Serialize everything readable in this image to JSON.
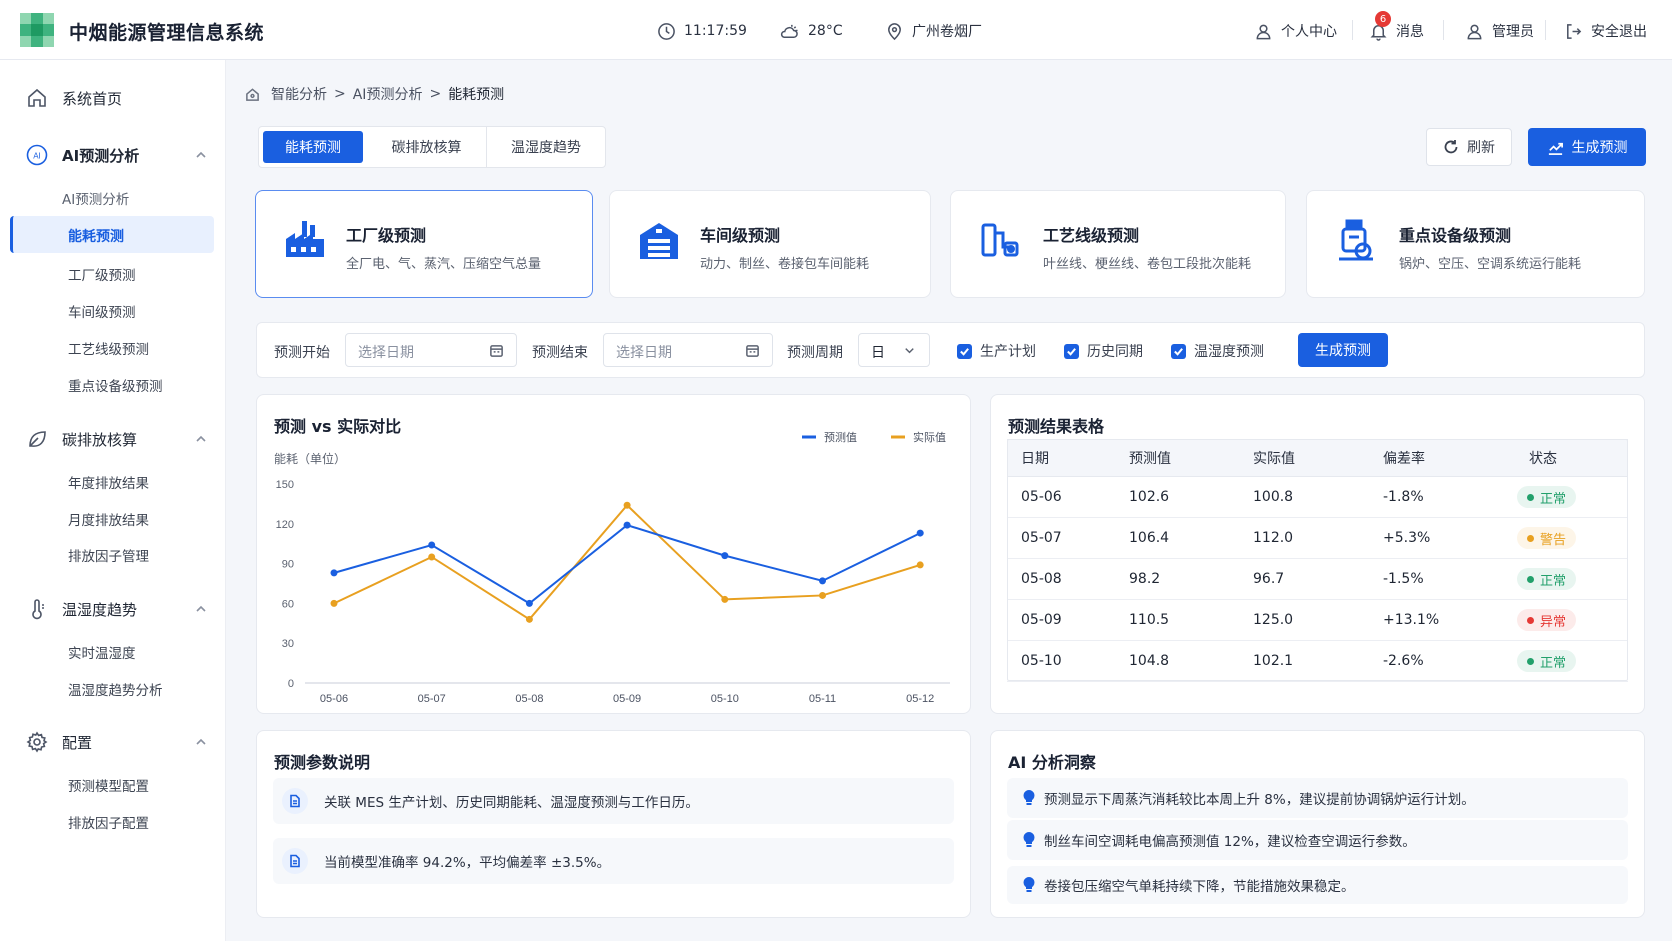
{
  "app": {
    "title": "中烟能源管理信息系统"
  },
  "header": {
    "time": "11:17:59",
    "weather": "28°C",
    "location": "广州卷烟厂",
    "personal_center": "个人中心",
    "messages": "消息",
    "message_count": "6",
    "user": "管理员",
    "logout": "安全退出"
  },
  "sidebar": {
    "home": "系统首页",
    "ai_group": "AI预测分析",
    "ai_sub_label": "AI预测分析",
    "ai_items": [
      "能耗预测",
      "工厂级预测",
      "车间级预测",
      "工艺线级预测",
      "重点设备级预测"
    ],
    "carbon_group": "碳排放核算",
    "carbon_items": [
      "年度排放结果",
      "月度排放结果",
      "排放因子管理"
    ],
    "humid_group": "温湿度趋势",
    "humid_items": [
      "实时温湿度",
      "温湿度趋势分析"
    ],
    "config_group": "配置",
    "config_items": [
      "预测模型配置",
      "排放因子配置"
    ]
  },
  "breadcrumb": {
    "l1": "智能分析",
    "sep": ">",
    "l2": "AI预测分析",
    "l3": "能耗预测"
  },
  "tabs": [
    "能耗预测",
    "碳排放核算",
    "温湿度趋势"
  ],
  "toolbar": {
    "refresh": "刷新",
    "generate": "生成预测"
  },
  "levels": [
    {
      "title": "工厂级预测",
      "desc": "全厂电、气、蒸汽、压缩空气总量",
      "icon": "factory-icon"
    },
    {
      "title": "车间级预测",
      "desc": "动力、制丝、卷接包车间能耗",
      "icon": "warehouse-icon"
    },
    {
      "title": "工艺线级预测",
      "desc": "叶丝线、梗丝线、卷包工段批次能耗",
      "icon": "pipeline-icon"
    },
    {
      "title": "重点设备级预测",
      "desc": "锅炉、空压、空调系统运行能耗",
      "icon": "equipment-icon"
    }
  ],
  "filter": {
    "start_label": "预测开始",
    "start_placeholder": "选择日期",
    "end_label": "预测结束",
    "end_placeholder": "选择日期",
    "period_label": "预测周期",
    "period_value": "日",
    "check_plan": "生产计划",
    "check_history": "历史同期",
    "check_humid": "温湿度预测",
    "generate": "生成预测"
  },
  "chart_panel": {
    "title": "预测 vs 实际对比"
  },
  "chart_data": {
    "type": "line",
    "title": "预测 vs 实际对比",
    "ylabel": "能耗（单位）",
    "categories": [
      "05-06",
      "05-07",
      "05-08",
      "05-09",
      "05-10",
      "05-11",
      "05-12"
    ],
    "yticks": [
      "150",
      "120",
      "90",
      "60",
      "30",
      "0"
    ],
    "ylim": [
      0,
      150
    ],
    "grid": false,
    "legend": "top-right",
    "series": [
      {
        "name": "预测值",
        "color": "#1a5fe0",
        "values": [
          83,
          104,
          60,
          119,
          96,
          77,
          113
        ]
      },
      {
        "name": "实际值",
        "color": "#e8a020",
        "values": [
          60,
          95,
          48,
          134,
          63,
          66,
          89
        ]
      }
    ]
  },
  "table_panel": {
    "title": "预测结果表格",
    "columns": [
      "日期",
      "预测值",
      "实际值",
      "偏差率",
      "状态"
    ],
    "rows": [
      {
        "date": "05-06",
        "pred": "102.6",
        "actual": "100.8",
        "dev": "-1.8%",
        "status": "正常"
      },
      {
        "date": "05-07",
        "pred": "106.4",
        "actual": "112.0",
        "dev": "+5.3%",
        "status": "警告"
      },
      {
        "date": "05-08",
        "pred": "98.2",
        "actual": "96.7",
        "dev": "-1.5%",
        "status": "正常"
      },
      {
        "date": "05-09",
        "pred": "110.5",
        "actual": "125.0",
        "dev": "+13.1%",
        "status": "异常"
      },
      {
        "date": "05-10",
        "pred": "104.8",
        "actual": "102.1",
        "dev": "-2.6%",
        "status": "正常"
      }
    ]
  },
  "status_colors": {
    "正常": "#22a06b",
    "警告": "#e8a020",
    "异常": "#e53935"
  },
  "params_panel": {
    "title": "预测参数说明",
    "notes": [
      "关联 MES 生产计划、历史同期能耗、温湿度预测与工作日历。",
      "当前模型准确率 94.2%，平均偏差率 ±3.5%。"
    ]
  },
  "insight_panel": {
    "title": "AI 分析洞察",
    "items": [
      "预测显示下周蒸汽消耗较比本周上升 8%，建议提前协调锅炉运行计划。",
      "制丝车间空调耗电偏高预测值 12%，建议检查空调运行参数。",
      "卷接包压缩空气单耗持续下降，节能措施效果稳定。"
    ]
  }
}
